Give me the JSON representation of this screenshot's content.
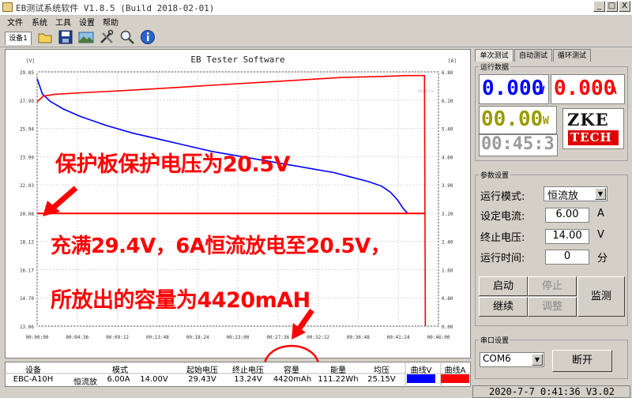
{
  "window": {
    "title": "EB测试系统软件 V1.8.5 (Build 2018-02-01)",
    "minimize": "_",
    "maximize": "□",
    "close": "X"
  },
  "menu": [
    "文件",
    "系统",
    "工具",
    "设置",
    "帮助"
  ],
  "toolbar": {
    "device_tab": "设备1",
    "icons": [
      "folder-icon",
      "save-icon",
      "image-icon",
      "tools-icon",
      "search-icon",
      "info-icon"
    ]
  },
  "chart": {
    "title": "EB Tester Software",
    "left_unit": "[V]",
    "right_unit": "[A]",
    "watermark": "ZKETECH"
  },
  "chart_data": {
    "type": "line",
    "title": "EB Tester Software",
    "ylabel": "[V]",
    "y2label": "[A]",
    "ylim": [
      13.06,
      29.85
    ],
    "y2lim": [
      0.0,
      6.8
    ],
    "yticks": [
      "29.85",
      "27.90",
      "25.94",
      "23.99",
      "22.03",
      "20.08",
      "18.12",
      "16.17",
      "14.70",
      "13.06"
    ],
    "y2ticks": [
      "6.80",
      "6.20",
      "5.40",
      "4.60",
      "3.90",
      "3.20",
      "2.40",
      "1.60",
      "0.80",
      "0.00"
    ],
    "xticks": [
      "00:00:00",
      "00:04:36",
      "00:09:12",
      "00:13:48",
      "00:18:24",
      "00:23:00",
      "00:27:36",
      "00:32:12",
      "00:36:48",
      "00:41:24",
      "00:46:00"
    ],
    "x_minutes": [
      0,
      4.6,
      9.2,
      13.8,
      18.4,
      23.0,
      27.6,
      32.2,
      36.8,
      41.4,
      46.0
    ],
    "series": [
      {
        "name": "曲线V",
        "color": "#0000ff",
        "axis": "left",
        "x": [
          0,
          0.6,
          1.5,
          3,
          5,
          8,
          11,
          14,
          17,
          20,
          23,
          26,
          29,
          32,
          34,
          36,
          38,
          39.5,
          40.5,
          41.3,
          42,
          42.5
        ],
        "y": [
          29.4,
          28.4,
          27.9,
          27.4,
          26.9,
          26.3,
          25.8,
          25.4,
          25.0,
          24.6,
          24.3,
          24.0,
          23.7,
          23.4,
          23.2,
          22.9,
          22.6,
          22.3,
          21.9,
          21.4,
          20.8,
          20.5
        ]
      },
      {
        "name": "曲线A",
        "color": "#ff0000",
        "axis": "right",
        "x": [
          0,
          0.7,
          2,
          5,
          10,
          15,
          20,
          25,
          30,
          35,
          40,
          42.4,
          42.5,
          44.4,
          44.5
        ],
        "y": [
          6.0,
          6.15,
          6.2,
          6.24,
          6.3,
          6.37,
          6.44,
          6.51,
          6.58,
          6.65,
          6.68,
          6.7,
          6.7,
          6.7,
          0.0
        ]
      },
      {
        "name": "终止电压",
        "color": "#ff0000",
        "axis": "left",
        "x": [
          0,
          44.5
        ],
        "y": [
          20.5,
          20.5
        ]
      }
    ]
  },
  "annotations": {
    "line1": "保护板保护电压为20.5V",
    "line2": "充满29.4V，6A恒流放电至20.5V，",
    "line3": "所放出的容量为4420mAH"
  },
  "table": {
    "headers": [
      "设备",
      "模式",
      "起始电压",
      "终止电压",
      "容量",
      "能量",
      "均压",
      "曲线V",
      "曲线A"
    ],
    "row": [
      "EBC-A10H",
      "恒流放",
      "6.00A",
      "14.00V",
      "29.43V",
      "13.24V",
      "4420mAh",
      "111.22Wh",
      "25.15V"
    ],
    "colors": {
      "curve_v": "#0000ff",
      "curve_a": "#ff0000"
    }
  },
  "right_panel": {
    "tabs": [
      "单次测试",
      "自动测试",
      "循环测试"
    ],
    "run_data_label": "运行数据",
    "voltage": "0.000",
    "voltage_unit": "V",
    "current": "0.000",
    "current_unit": "A",
    "power": "00.00",
    "power_unit": "W",
    "time": "00:45:3",
    "logo_top": "ZKE",
    "logo_bottom": "TECH",
    "params_label": "参数设置",
    "mode_label": "运行模式:",
    "mode_value": "恒流放",
    "set_current_label": "设定电流:",
    "set_current_value": "6.00",
    "set_current_unit": "A",
    "stop_voltage_label": "终止电压:",
    "stop_voltage_value": "14.00",
    "stop_voltage_unit": "V",
    "run_time_label": "运行时间:",
    "run_time_value": "0",
    "run_time_unit": "分",
    "btn_start": "启动",
    "btn_stop": "停止",
    "btn_continue": "继续",
    "btn_adjust": "调整",
    "btn_monitor": "监测",
    "serial_label": "串口设置",
    "port_value": "COM6",
    "btn_disconnect": "断开",
    "status": "2020-7-7 0:41:36  V3.02"
  }
}
